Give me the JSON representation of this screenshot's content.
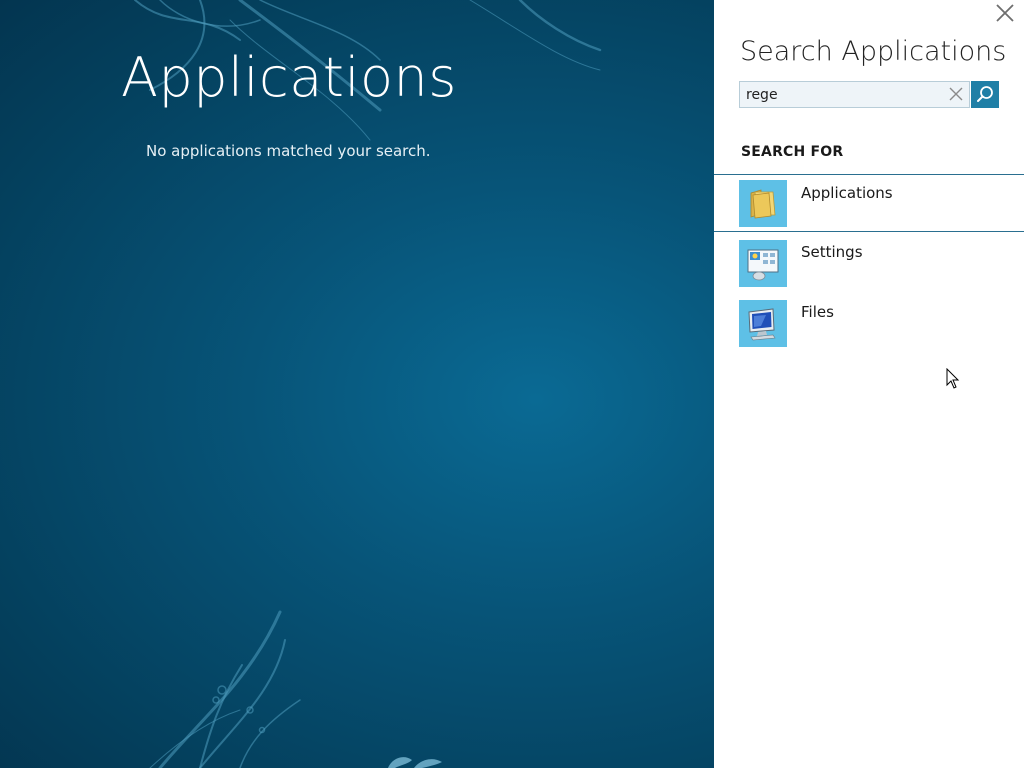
{
  "start": {
    "title": "Applications",
    "no_results": "No applications matched your search."
  },
  "search_pane": {
    "title": "Search Applications",
    "query": "rege",
    "section_label": "SEARCH FOR",
    "scopes": [
      {
        "label": "Applications",
        "icon": "folder-icon",
        "selected": true
      },
      {
        "label": "Settings",
        "icon": "control-panel-icon",
        "selected": false
      },
      {
        "label": "Files",
        "icon": "computer-icon",
        "selected": false
      }
    ]
  },
  "colors": {
    "background": "#075478",
    "accent": "#1f7fa6",
    "tile": "#5ec0e6",
    "selection_border": "#2a6f90"
  }
}
